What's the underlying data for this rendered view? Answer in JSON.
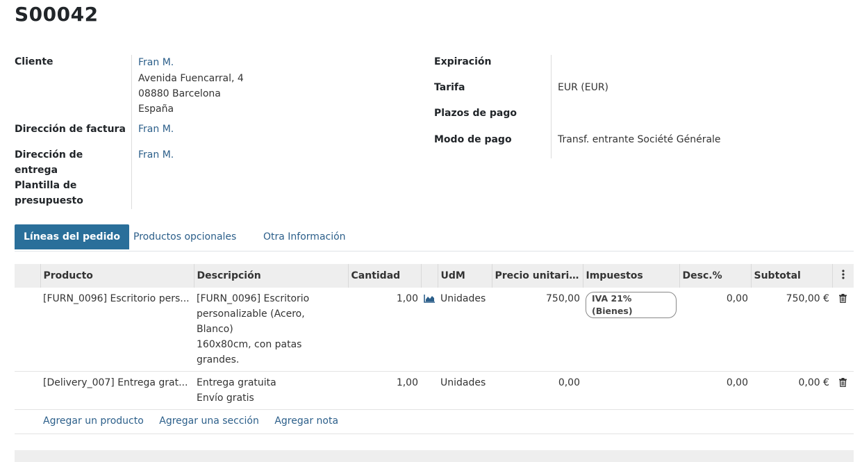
{
  "title": "S00042",
  "left_fields": {
    "cliente_label": "Cliente",
    "cliente_name": "Fran M.",
    "cliente_addr1": "Avenida Fuencarral, 4",
    "cliente_addr2": "08880 Barcelona",
    "cliente_addr3": "España",
    "factura_label": "Dirección de factura",
    "factura_value": "Fran M.",
    "entrega_label1": "Dirección de",
    "entrega_label2": "entrega",
    "entrega_value": "Fran M.",
    "plantilla_label1": "Plantilla de",
    "plantilla_label2": "presupuesto"
  },
  "right_fields": {
    "expiracion_label": "Expiración",
    "tarifa_label": "Tarifa",
    "tarifa_value": "EUR (EUR)",
    "plazos_label": "Plazos de pago",
    "modo_label": "Modo de pago",
    "modo_value": "Transf. entrante Société Générale"
  },
  "tabs": [
    "Líneas del pedido",
    "Productos opcionales",
    "Otra Información"
  ],
  "columns": {
    "producto": "Producto",
    "descripcion": "Descripción",
    "cantidad": "Cantidad",
    "udm": "UdM",
    "precio": "Precio unitario...",
    "impuestos": "Impuestos",
    "desc": "Desc.%",
    "subtotal": "Subtotal"
  },
  "rows": [
    {
      "producto": "[FURN_0096] Escritorio pers...",
      "desc1": "[FURN_0096] Escritorio",
      "desc2": "personalizable (Acero,",
      "desc3": "Blanco)",
      "desc4": "160x80cm, con patas",
      "desc5": "grandes.",
      "cantidad": "1,00",
      "udm": "Unidades",
      "precio": "750,00",
      "impuesto": "IVA 21% (Bienes)",
      "descuento": "0,00",
      "subtotal": "750,00 €"
    },
    {
      "producto": "[Delivery_007] Entrega grat...",
      "desc1": "Entrega gratuita",
      "desc2": "Envío gratis",
      "cantidad": "1,00",
      "udm": "Unidades",
      "precio": "0,00",
      "descuento": "0,00",
      "subtotal": "0,00 €"
    }
  ],
  "add_links": {
    "producto": "Agregar un producto",
    "seccion": "Agregar una sección",
    "nota": "Agregar nota"
  },
  "colors": {
    "link": "#2c5f8a",
    "tab_active": "#2a6f9a"
  },
  "icons": [
    "forecast-chart-icon",
    "trash-icon",
    "column-options-icon"
  ]
}
